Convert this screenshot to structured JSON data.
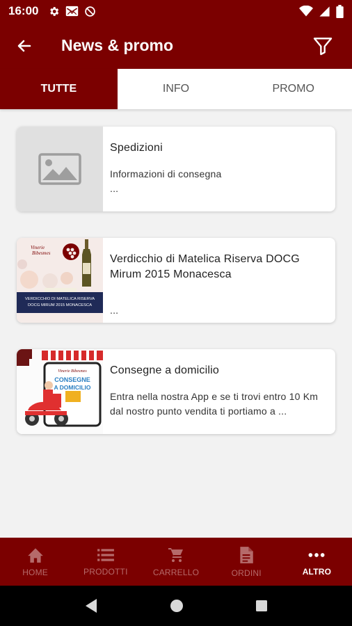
{
  "status_bar": {
    "time": "16:00",
    "left_icons": [
      "gear-icon",
      "mail-icon",
      "do-not-disturb-icon"
    ],
    "right_icons": [
      "wifi-icon",
      "signal-icon",
      "battery-icon"
    ]
  },
  "app_bar": {
    "title": "News & promo",
    "back_icon": "arrow-back-icon",
    "filter_icon": "filter-icon"
  },
  "tabs": [
    {
      "label": "TUTTE",
      "active": true
    },
    {
      "label": "INFO",
      "active": false
    },
    {
      "label": "PROMO",
      "active": false
    }
  ],
  "cards": [
    {
      "title": "Spedizioni",
      "description": "Informazioni di consegna\n...",
      "thumb": "image-placeholder-icon"
    },
    {
      "title": "Verdicchio di Matelica Riserva DOCG Mirum 2015 Monacesca",
      "description": "...",
      "thumb": "wine-promo-image",
      "thumb_caption": "VERDICCHIO DI MATELICA RISERVA DOCG MIRUM 2015 MONACESCA"
    },
    {
      "title": "Consegne a domicilio",
      "description": "Entra nella nostra App e se ti trovi entro 10 Km dal nostro punto vendita ti portiamo a ...",
      "thumb": "home-delivery-image",
      "thumb_caption": "CONSEGNE A DOMICILIO"
    }
  ],
  "bottom_nav": [
    {
      "label": "HOME",
      "icon": "home-icon",
      "active": false
    },
    {
      "label": "PRODOTTI",
      "icon": "list-icon",
      "active": false
    },
    {
      "label": "CARRELLO",
      "icon": "cart-icon",
      "active": false
    },
    {
      "label": "ORDINI",
      "icon": "document-icon",
      "active": false
    },
    {
      "label": "ALTRO",
      "icon": "more-dots-icon",
      "active": true
    }
  ],
  "colors": {
    "primary": "#7b0000",
    "background": "#f2f2f2",
    "nav_inactive": "#b56a6a"
  }
}
